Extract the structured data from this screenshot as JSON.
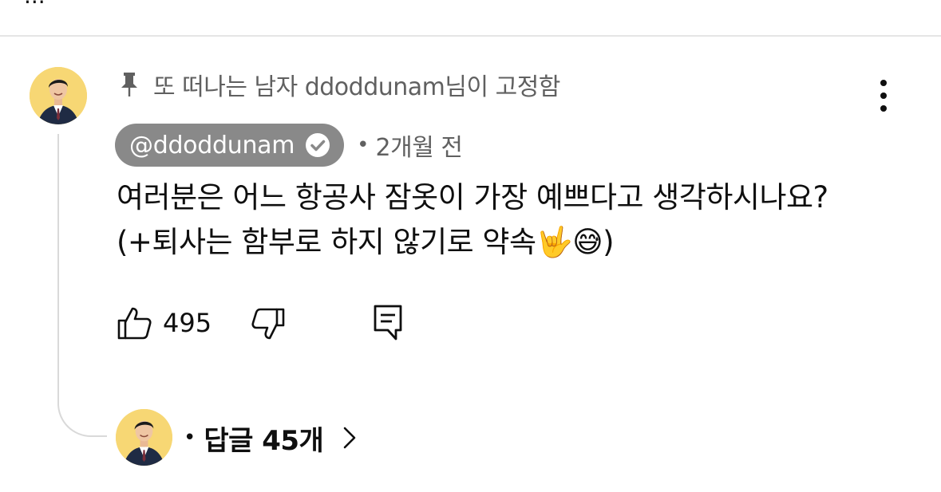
{
  "comment": {
    "pinned_label": "또 떠나는 남자 ddoddunam님이 고정함",
    "author_handle": "@ddoddunam",
    "meta_separator": "•",
    "timestamp": "2개월 전",
    "text": "여러분은 어느 항공사 잠옷이 가장 예쁘다고 생각하시나요?(+퇴사는 함부로 하지 않기로 약속🤟😅)",
    "like_count": "495"
  },
  "replies": {
    "dot": "•",
    "label": "답글 45개"
  },
  "icons": {
    "pin": "pin-icon",
    "more": "more-vert-icon",
    "verified": "verified-check-icon",
    "like": "thumbs-up-icon",
    "dislike": "thumbs-down-icon",
    "reply": "reply-comment-icon",
    "chevron": "chevron-right-icon"
  },
  "colors": {
    "pill_background": "#898989",
    "secondary_text": "#606060",
    "primary_text": "#0f0f0f",
    "avatar_background": "#f7d774"
  }
}
